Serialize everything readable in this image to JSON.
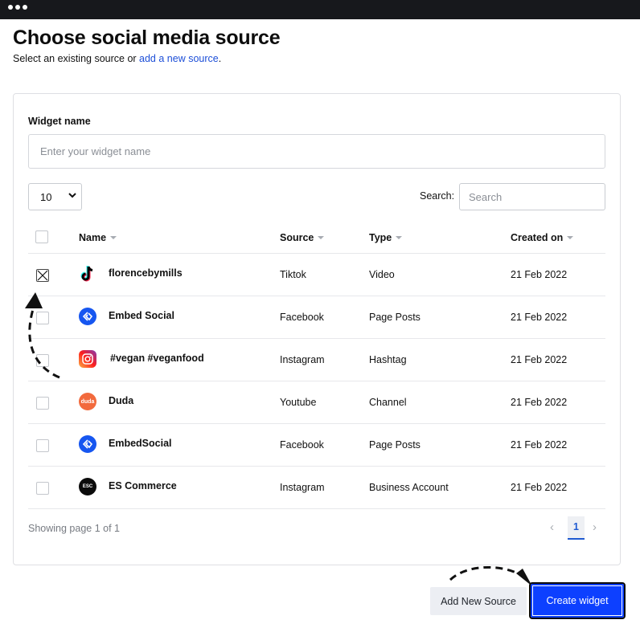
{
  "header": {
    "title": "Choose social media source",
    "subtitle_prefix": "Select an existing source or ",
    "subtitle_link": "add a new source",
    "subtitle_suffix": "."
  },
  "form": {
    "widget_name_label": "Widget name",
    "widget_name_placeholder": "Enter your widget name"
  },
  "table_controls": {
    "page_length": "10",
    "search_label": "Search:",
    "search_placeholder": "Search"
  },
  "table": {
    "columns": [
      "Name",
      "Source",
      "Type",
      "Created on"
    ],
    "rows": [
      {
        "name": "florencebymills",
        "source": "Tiktok",
        "type": "Video",
        "created": "21 Feb 2022",
        "logo": "tiktok-logo",
        "checked": true
      },
      {
        "name": "Embed Social",
        "source": "Facebook",
        "type": "Page Posts",
        "created": "21 Feb 2022",
        "logo": "embedsocial-logo",
        "checked": false
      },
      {
        "name": "#vegan #veganfood",
        "source": "Instagram",
        "type": "Hashtag",
        "created": "21 Feb 2022",
        "logo": "instagram-logo",
        "checked": false
      },
      {
        "name": "Duda",
        "source": "Youtube",
        "type": "Channel",
        "created": "21 Feb 2022",
        "logo": "duda-logo",
        "checked": false
      },
      {
        "name": "EmbedSocial",
        "source": "Facebook",
        "type": "Page Posts",
        "created": "21 Feb 2022",
        "logo": "embedsocial-logo",
        "checked": false
      },
      {
        "name": "ES Commerce",
        "source": "Instagram",
        "type": "Business Account",
        "created": "21 Feb 2022",
        "logo": "escommerce-logo",
        "checked": false
      }
    ]
  },
  "pagination": {
    "info": "Showing page 1 of 1",
    "prev": "‹",
    "current": "1",
    "next": "›"
  },
  "logo_text": {
    "duda": "duda",
    "escommerce": "ESC"
  },
  "actions": {
    "add_source": "Add New Source",
    "create_widget": "Create widget"
  },
  "colors": {
    "accent": "#0d40ff",
    "link": "#1d4fd8",
    "embedsocial": "#1656f0",
    "duda": "#f26a3d"
  }
}
